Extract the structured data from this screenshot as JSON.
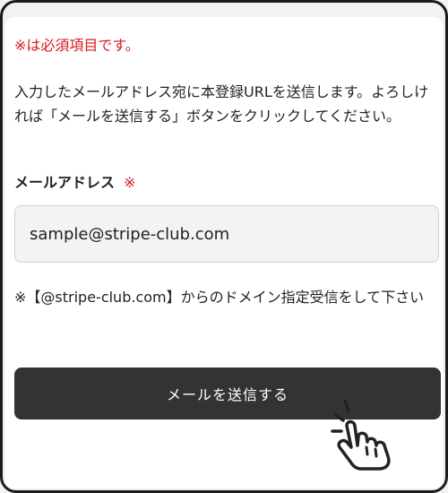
{
  "form": {
    "required_note": "※は必須項目です。",
    "description": "入力したメールアドレス宛に本登録URLを送信します。よろしければ「メールを送信する」ボタンをクリックしてください。",
    "email_label": "メールアドレス",
    "required_mark": "※",
    "email_value": "sample@stripe-club.com",
    "domain_note": "※【@stripe-club.com】からのドメイン指定受信をして下さい",
    "send_button_label": "メールを送信する"
  },
  "icons": {
    "cursor": "pointing-hand-icon"
  },
  "colors": {
    "required": "#d71920",
    "button_bg": "#333333",
    "input_bg": "#f3f3f3"
  }
}
